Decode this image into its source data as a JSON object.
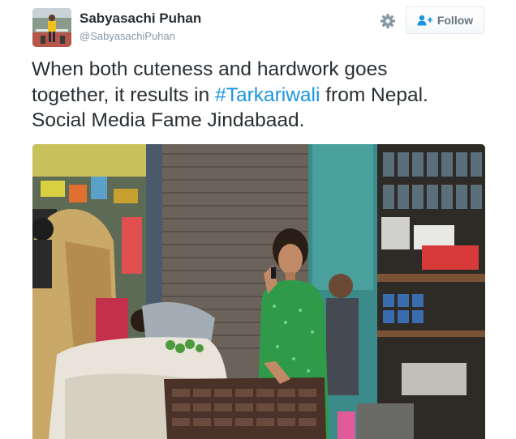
{
  "tweet": {
    "user": {
      "display_name": "Sabyasachi Puhan",
      "screen_name": "@SabyasachiPuhan",
      "avatar_icon": "avatar-photo"
    },
    "follow_button": {
      "label": "Follow",
      "icon": "add-user-icon"
    },
    "more_icon": "gear-icon",
    "text": {
      "line1": "When both cuteness and hardwork goes",
      "line2_before": "together, it results in ",
      "hashtag": "#Tarkariwali",
      "line2_after": " from Nepal.",
      "line3": "Social Media Fame  Jindabaad."
    },
    "photo_icon": "street-vendor-photo",
    "colors": {
      "link": "#1b95e0",
      "text": "#292f33",
      "muted": "#8899a6",
      "button_text": "#66757f"
    }
  }
}
